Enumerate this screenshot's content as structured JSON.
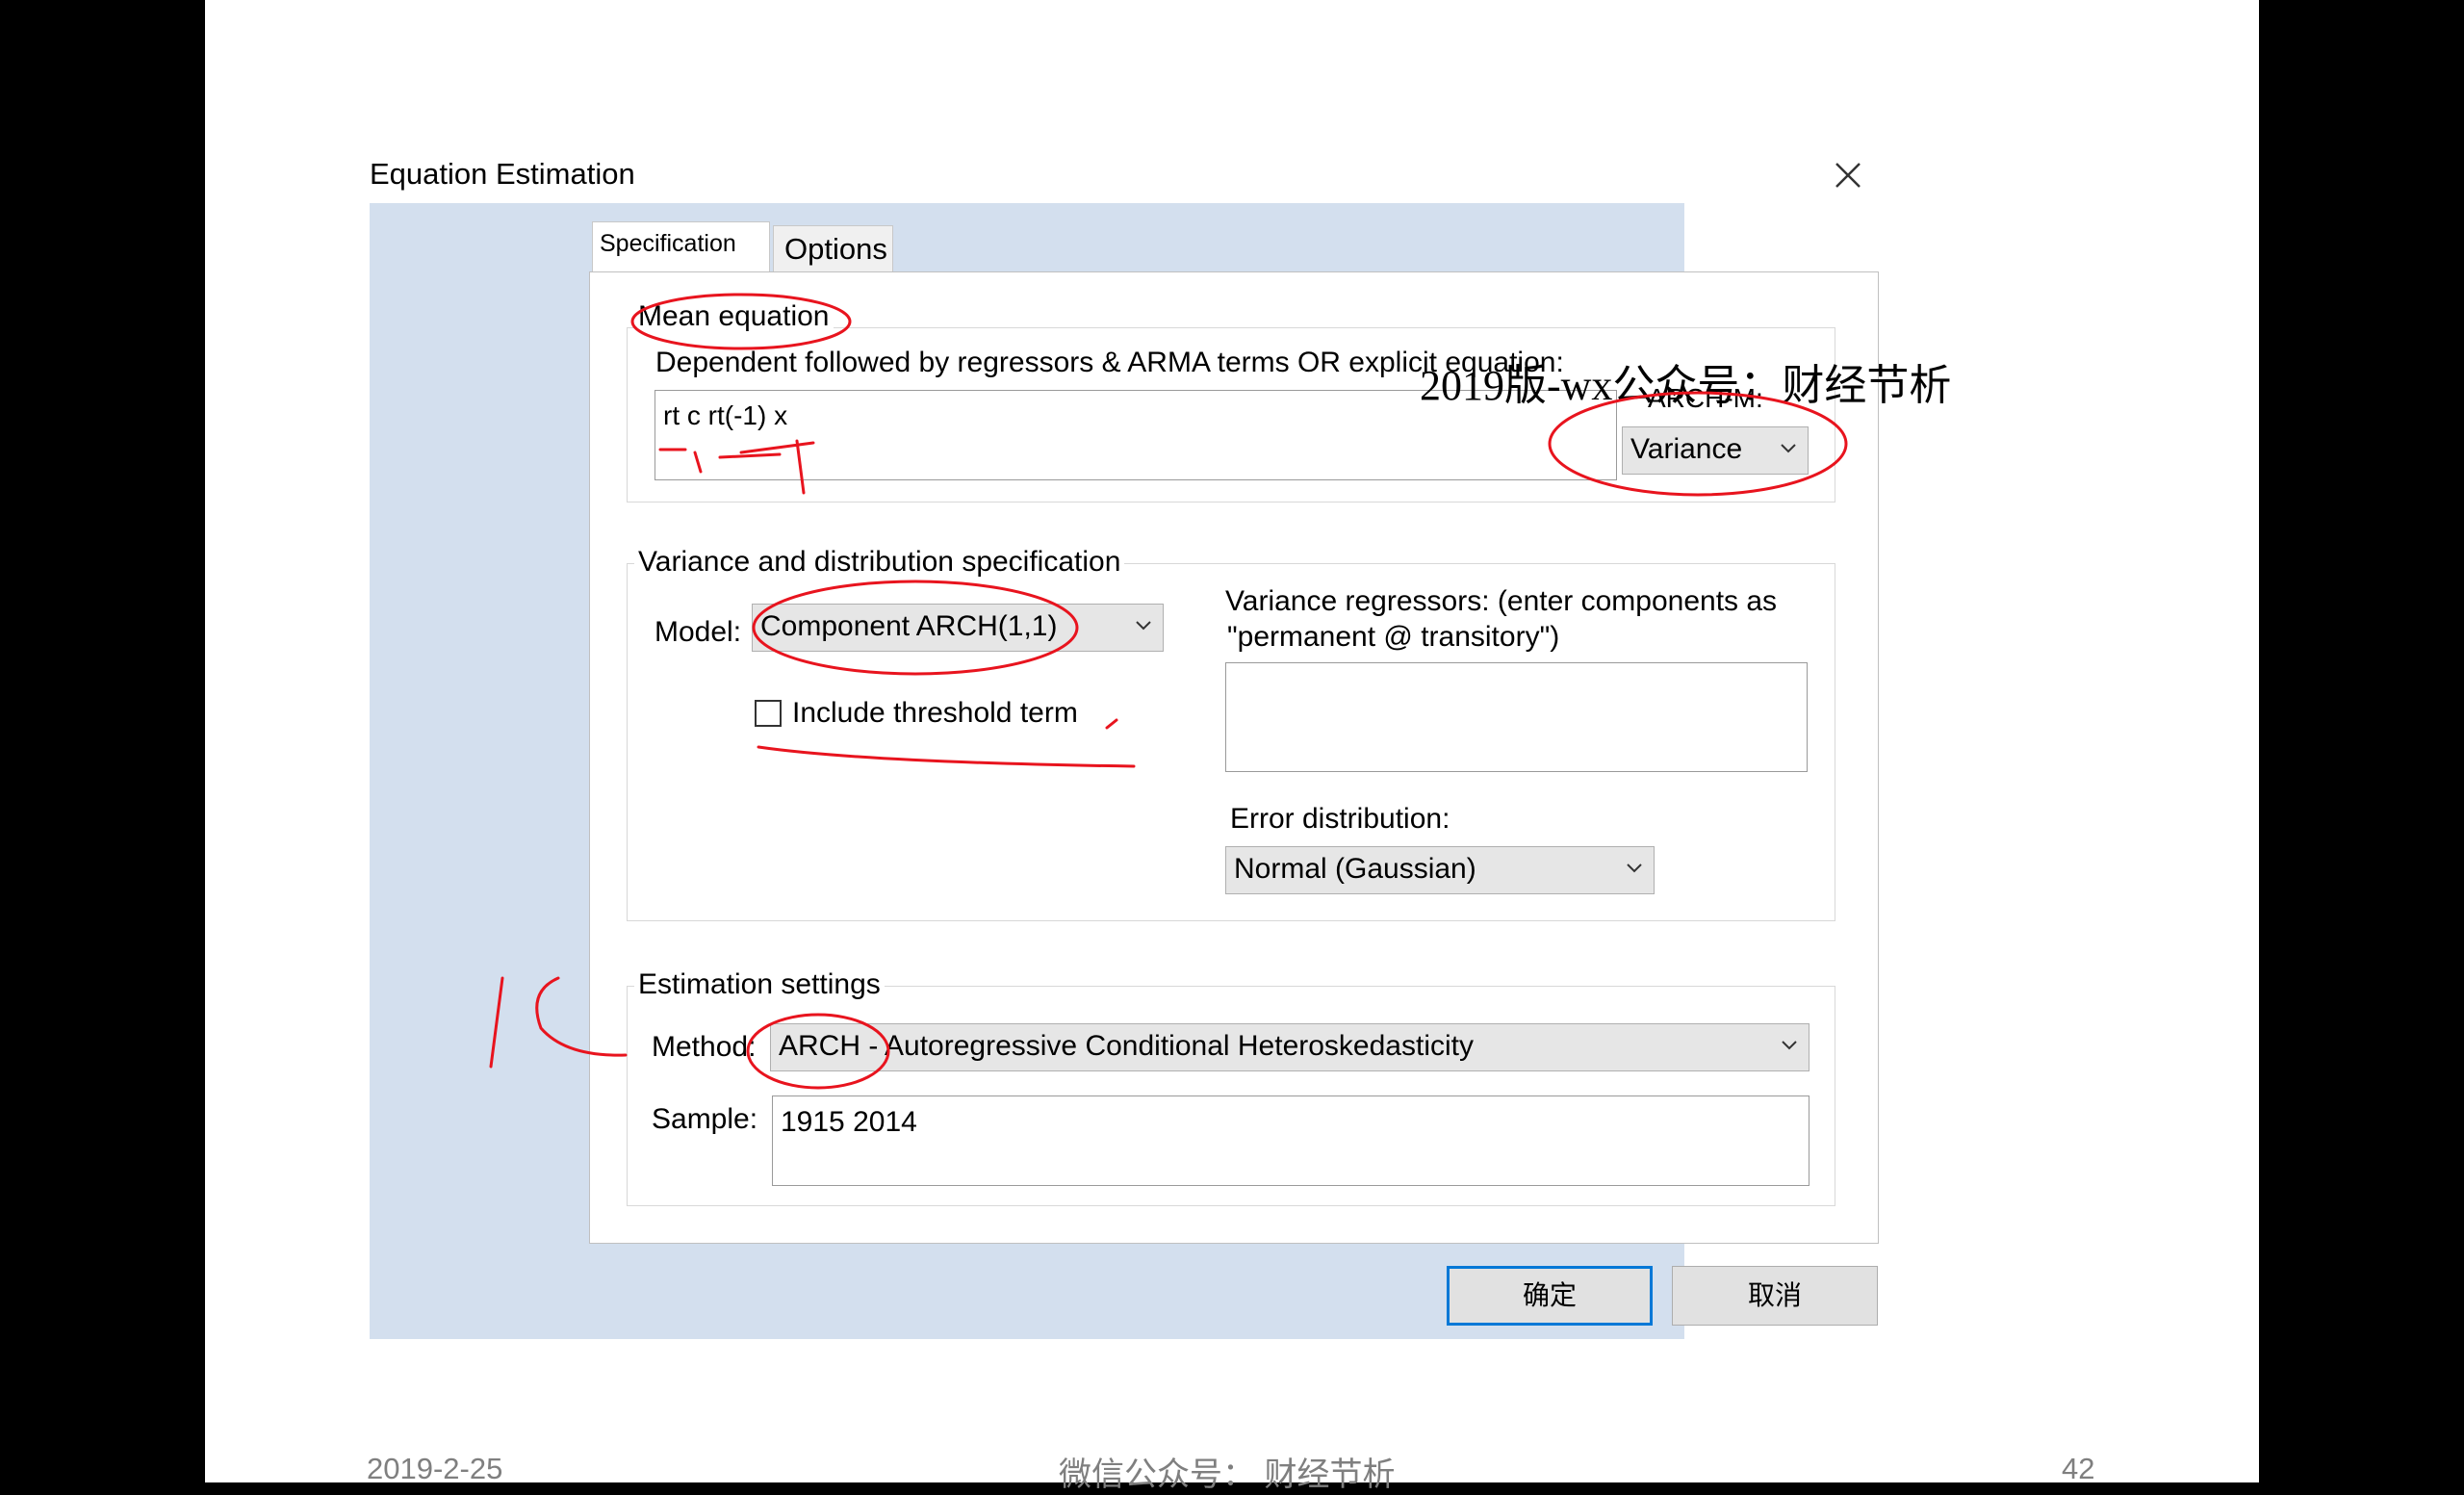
{
  "dialog": {
    "title": "Equation Estimation",
    "tabs": [
      {
        "label": "Specification",
        "active": true
      },
      {
        "label": "Options",
        "active": false
      }
    ],
    "mean_equation": {
      "legend": "Mean equation",
      "instruction": "Dependent followed by regressors & ARMA terms OR explicit equation:",
      "value": "rt c rt(-1) x",
      "arch_m_label": "ARCH-M:",
      "arch_m_selected": "Variance"
    },
    "variance_spec": {
      "legend": "Variance and distribution specification",
      "model_label": "Model:",
      "model_selected": "Component ARCH(1,1)",
      "threshold_label": "Include threshold term",
      "threshold_checked": false,
      "regressors_label_line1": "Variance regressors: (enter components as",
      "regressors_label_line2": "\"permanent @ transitory\")",
      "regressors_value": "",
      "error_dist_label": "Error distribution:",
      "error_dist_selected": "Normal (Gaussian)"
    },
    "estimation": {
      "legend": "Estimation settings",
      "method_label": "Method:",
      "method_selected": "ARCH - Autoregressive Conditional Heteroskedasticity",
      "sample_label": "Sample:",
      "sample_value": "1915 2014"
    },
    "buttons": {
      "ok": "确定",
      "cancel": "取消"
    }
  },
  "watermark": "2019版-wx公众号：财经节析",
  "footer": {
    "date": "2019-2-25",
    "center": "微信公众号：  财经节析",
    "page": "42"
  },
  "colors": {
    "annotation": "#e8141e",
    "dialog_frame": "#d3dfee",
    "ok_border": "#0078d7",
    "footer_text": "#7f7f7f"
  }
}
